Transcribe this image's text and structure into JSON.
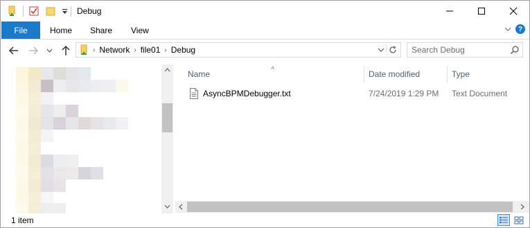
{
  "window": {
    "title": "Debug"
  },
  "ribbon": {
    "tabs": [
      "File",
      "Home",
      "Share",
      "View"
    ]
  },
  "address": {
    "crumbs": [
      "Network",
      "file01",
      "Debug"
    ]
  },
  "search": {
    "placeholder": "Search Debug"
  },
  "columns": [
    "Name",
    "Date modified",
    "Type"
  ],
  "files": [
    {
      "name": "AsyncBPMDebugger.txt",
      "date": "7/24/2019 1:29 PM",
      "type": "Text Document"
    }
  ],
  "status": {
    "item_count": "1 item"
  },
  "colors": {
    "accent": "#1979ca",
    "header_text": "#4c607a",
    "muted_text": "#6d6d6d"
  },
  "icons": [
    "folder-icon",
    "properties-icon",
    "new-folder-icon",
    "customize-dropdown-icon",
    "minimize-icon",
    "maximize-icon",
    "close-icon",
    "collapse-ribbon-icon",
    "help-icon",
    "back-icon",
    "forward-icon",
    "recent-locations-icon",
    "up-icon",
    "address-dropdown-icon",
    "refresh-icon",
    "search-icon",
    "text-file-icon",
    "details-view-icon",
    "large-icons-view-icon"
  ]
}
